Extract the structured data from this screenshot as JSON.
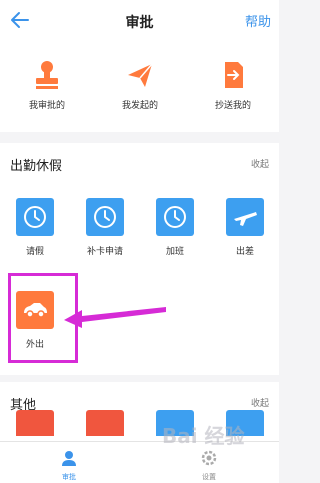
{
  "header": {
    "title": "审批",
    "help": "帮助",
    "back_icon": "back-arrow-icon"
  },
  "quick_actions": [
    {
      "label": "我审批的",
      "icon": "stamp-icon"
    },
    {
      "label": "我发起的",
      "icon": "paper-plane-icon"
    },
    {
      "label": "抄送我的",
      "icon": "forward-doc-icon"
    }
  ],
  "attendance": {
    "title": "出勤休假",
    "collapse": "收起",
    "items": [
      {
        "label": "请假",
        "icon": "clock-icon"
      },
      {
        "label": "补卡申请",
        "icon": "clock-icon"
      },
      {
        "label": "加班",
        "icon": "clock-icon"
      },
      {
        "label": "出差",
        "icon": "airplane-icon"
      },
      {
        "label": "外出",
        "icon": "car-icon"
      }
    ]
  },
  "other": {
    "title": "其他",
    "collapse": "收起"
  },
  "tabbar": [
    {
      "label": "审批",
      "icon": "person-icon",
      "active": true
    },
    {
      "label": "设置",
      "icon": "gear-icon",
      "active": false
    }
  ],
  "colors": {
    "accent": "#3b93ea",
    "orange": "#ff7a3d",
    "tile_blue": "#3d9ff0",
    "highlight": "#d62bd6"
  },
  "watermark": "Bai 经验"
}
